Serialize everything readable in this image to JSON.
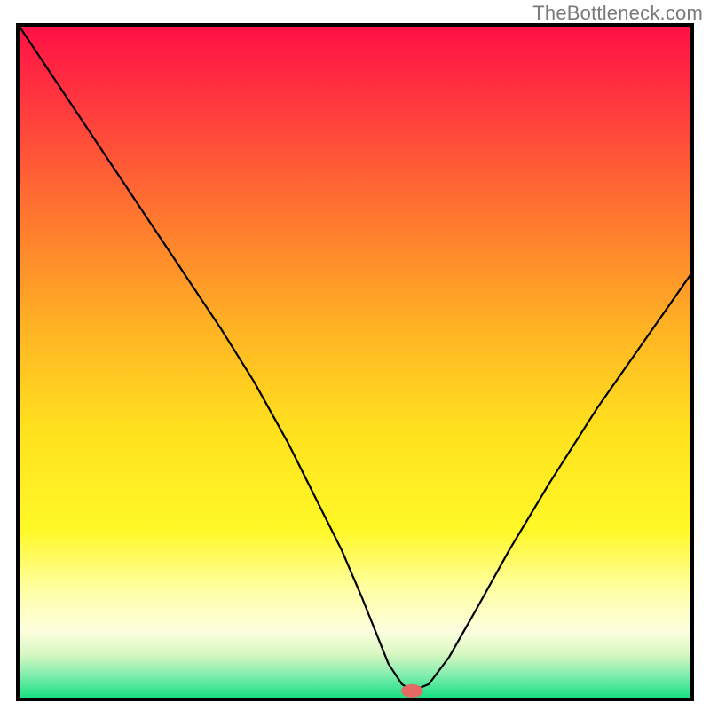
{
  "watermark": "TheBottleneck.com",
  "chart_data": {
    "type": "line",
    "title": "",
    "xlabel": "",
    "ylabel": "",
    "xlim": [
      0,
      100
    ],
    "ylim": [
      0,
      100
    ],
    "grid": false,
    "legend": false,
    "background": {
      "type": "vertical-gradient",
      "stops": [
        {
          "offset": 0.0,
          "color": "#ff1146"
        },
        {
          "offset": 0.12,
          "color": "#ff3a3e"
        },
        {
          "offset": 0.3,
          "color": "#ff7d2e"
        },
        {
          "offset": 0.45,
          "color": "#ffb324"
        },
        {
          "offset": 0.6,
          "color": "#ffe11e"
        },
        {
          "offset": 0.75,
          "color": "#fff827"
        },
        {
          "offset": 0.84,
          "color": "#ffffa5"
        },
        {
          "offset": 0.9,
          "color": "#fdfede"
        },
        {
          "offset": 0.935,
          "color": "#d9f7c2"
        },
        {
          "offset": 0.965,
          "color": "#86eeb0"
        },
        {
          "offset": 1.0,
          "color": "#18df82"
        }
      ]
    },
    "series": [
      {
        "name": "bottleneck-curve",
        "x": [
          0,
          6,
          12,
          18,
          24,
          30,
          35,
          40,
          44,
          48,
          51,
          53,
          55,
          57,
          58.5,
          61,
          64,
          68,
          73,
          79,
          86,
          93,
          100
        ],
        "y": [
          100,
          91,
          82,
          73,
          64,
          55,
          47,
          38,
          30,
          22,
          15,
          10,
          5,
          2,
          1,
          2,
          6,
          13,
          22,
          32,
          43,
          53,
          63
        ]
      }
    ],
    "marker": {
      "name": "optimum-point",
      "x": 58.5,
      "y": 1,
      "rx_pct": 1.6,
      "ry_pct": 1.0,
      "color": "#e46a63"
    }
  }
}
